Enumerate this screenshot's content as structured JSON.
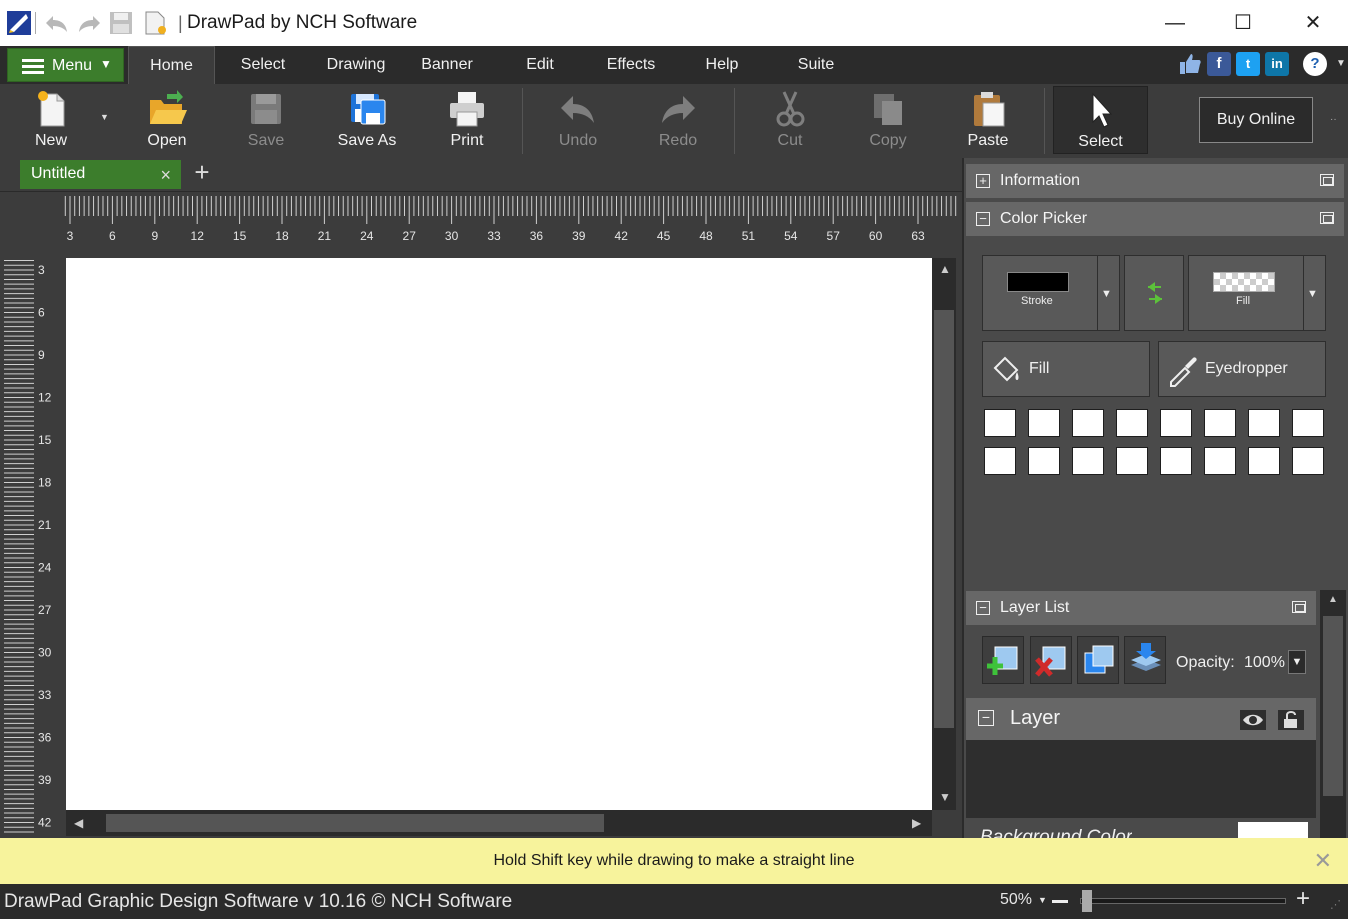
{
  "window": {
    "title": "DrawPad by NCH Software",
    "title_separator": "|",
    "controls": {
      "minimize": "—",
      "maximize": "☐",
      "close": "✕"
    }
  },
  "menu": {
    "menu_button": "Menu",
    "tabs": [
      {
        "label": "Home",
        "active": true
      },
      {
        "label": "Select"
      },
      {
        "label": "Drawing"
      },
      {
        "label": "Banner"
      },
      {
        "label": "Edit"
      },
      {
        "label": "Effects"
      },
      {
        "label": "Help"
      },
      {
        "label": "Suite"
      }
    ],
    "social": [
      "thumbs-up-icon",
      "facebook-icon",
      "twitter-icon",
      "linkedin-icon",
      "help-icon"
    ]
  },
  "toolbar": {
    "new": "New",
    "open": "Open",
    "save": "Save",
    "save_as": "Save As",
    "print": "Print",
    "undo": "Undo",
    "redo": "Redo",
    "cut": "Cut",
    "copy": "Copy",
    "paste": "Paste",
    "select": "Select",
    "buy_online": "Buy Online"
  },
  "document_tabs": {
    "tabs": [
      {
        "label": "Untitled",
        "close": "×"
      }
    ],
    "add": "+"
  },
  "rulers": {
    "horizontal": [
      "3",
      "6",
      "9",
      "12",
      "15",
      "18",
      "21",
      "24",
      "27",
      "30",
      "33",
      "36",
      "39",
      "42",
      "45",
      "48",
      "51",
      "54",
      "57",
      "60",
      "63"
    ],
    "vertical": [
      "3",
      "6",
      "9",
      "12",
      "15",
      "18",
      "21",
      "24",
      "27",
      "30",
      "33",
      "36",
      "39",
      "42"
    ]
  },
  "right_panel": {
    "information": "Information",
    "color_picker": "Color Picker",
    "stroke_label": "Stroke",
    "fill_swatch_label": "Fill",
    "stroke_color": "#000000",
    "fill_button": "Fill",
    "eyedropper_button": "Eyedropper",
    "layer_list": "Layer List",
    "opacity_label": "Opacity:",
    "opacity_value": "100%",
    "layer_name": "Layer",
    "background_color": "Background Color"
  },
  "hint": {
    "message": "Hold Shift key while drawing to make a straight line",
    "close": "✕"
  },
  "status": {
    "text": "DrawPad Graphic Design Software v 10.16 © NCH Software",
    "zoom": "50%"
  },
  "colors": {
    "accent_green": "#3c7d2c",
    "toolbar_bg": "#3c3c3c",
    "hint_bg": "#f7f39c"
  }
}
